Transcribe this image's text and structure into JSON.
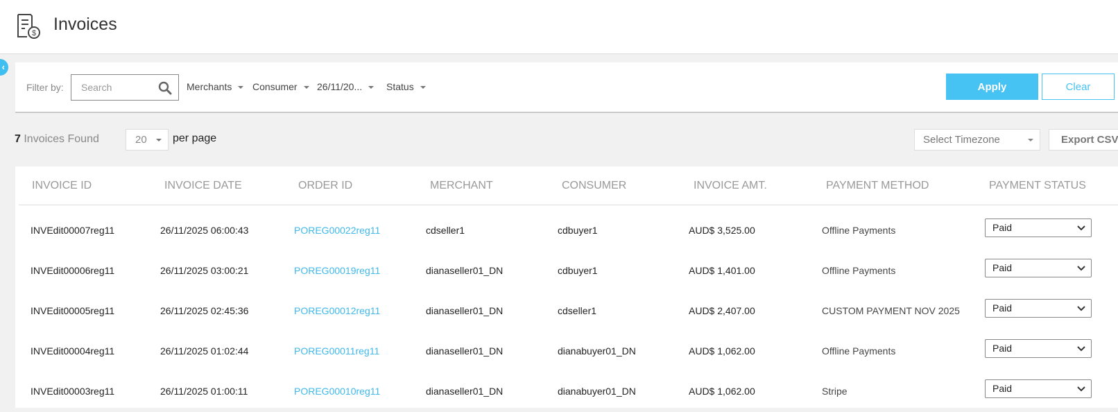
{
  "header": {
    "title": "Invoices",
    "icon": "invoice-icon"
  },
  "filters": {
    "label": "Filter by:",
    "search_placeholder": "Search",
    "merchants": "Merchants",
    "consumer": "Consumer",
    "date": "26/11/20...",
    "status": "Status",
    "apply": "Apply",
    "clear": "Clear"
  },
  "results": {
    "count": "7",
    "found_label": "Invoices Found",
    "per_page_value": "20",
    "per_page_label": "per page",
    "timezone_placeholder": "Select Timezone",
    "export": "Export CSV"
  },
  "table": {
    "columns": [
      "INVOICE ID",
      "INVOICE DATE",
      "ORDER ID",
      "MERCHANT",
      "CONSUMER",
      "INVOICE AMT.",
      "PAYMENT METHOD",
      "PAYMENT STATUS"
    ],
    "rows": [
      {
        "invoice_id": "INVEdit00007reg11",
        "date": "26/11/2025 06:00:43",
        "order_id": "POREG00022reg11",
        "merchant": "cdseller1",
        "consumer": "cdbuyer1",
        "amount": "AUD$ 3,525.00",
        "method": "Offline Payments",
        "status": "Paid"
      },
      {
        "invoice_id": "INVEdit00006reg11",
        "date": "26/11/2025 03:00:21",
        "order_id": "POREG00019reg11",
        "merchant": "dianaseller01_DN",
        "consumer": "cdbuyer1",
        "amount": "AUD$ 1,401.00",
        "method": "Offline Payments",
        "status": "Paid"
      },
      {
        "invoice_id": "INVEdit00005reg11",
        "date": "26/11/2025 02:45:36",
        "order_id": "POREG00012reg11",
        "merchant": "dianaseller01_DN",
        "consumer": "cdseller1",
        "amount": "AUD$ 2,407.00",
        "method": "CUSTOM PAYMENT NOV 2025",
        "status": "Paid"
      },
      {
        "invoice_id": "INVEdit00004reg11",
        "date": "26/11/2025 01:02:44",
        "order_id": "POREG00011reg11",
        "merchant": "dianaseller01_DN",
        "consumer": "dianabuyer01_DN",
        "amount": "AUD$ 1,062.00",
        "method": "Offline Payments",
        "status": "Paid"
      },
      {
        "invoice_id": "INVEdit00003reg11",
        "date": "26/11/2025 01:00:11",
        "order_id": "POREG00010reg11",
        "merchant": "dianaseller01_DN",
        "consumer": "dianabuyer01_DN",
        "amount": "AUD$ 1,062.00",
        "method": "Stripe",
        "status": "Paid"
      }
    ]
  },
  "colors": {
    "accent": "#46c2f3",
    "link": "#3fb8ec",
    "header_text": "#999999"
  }
}
